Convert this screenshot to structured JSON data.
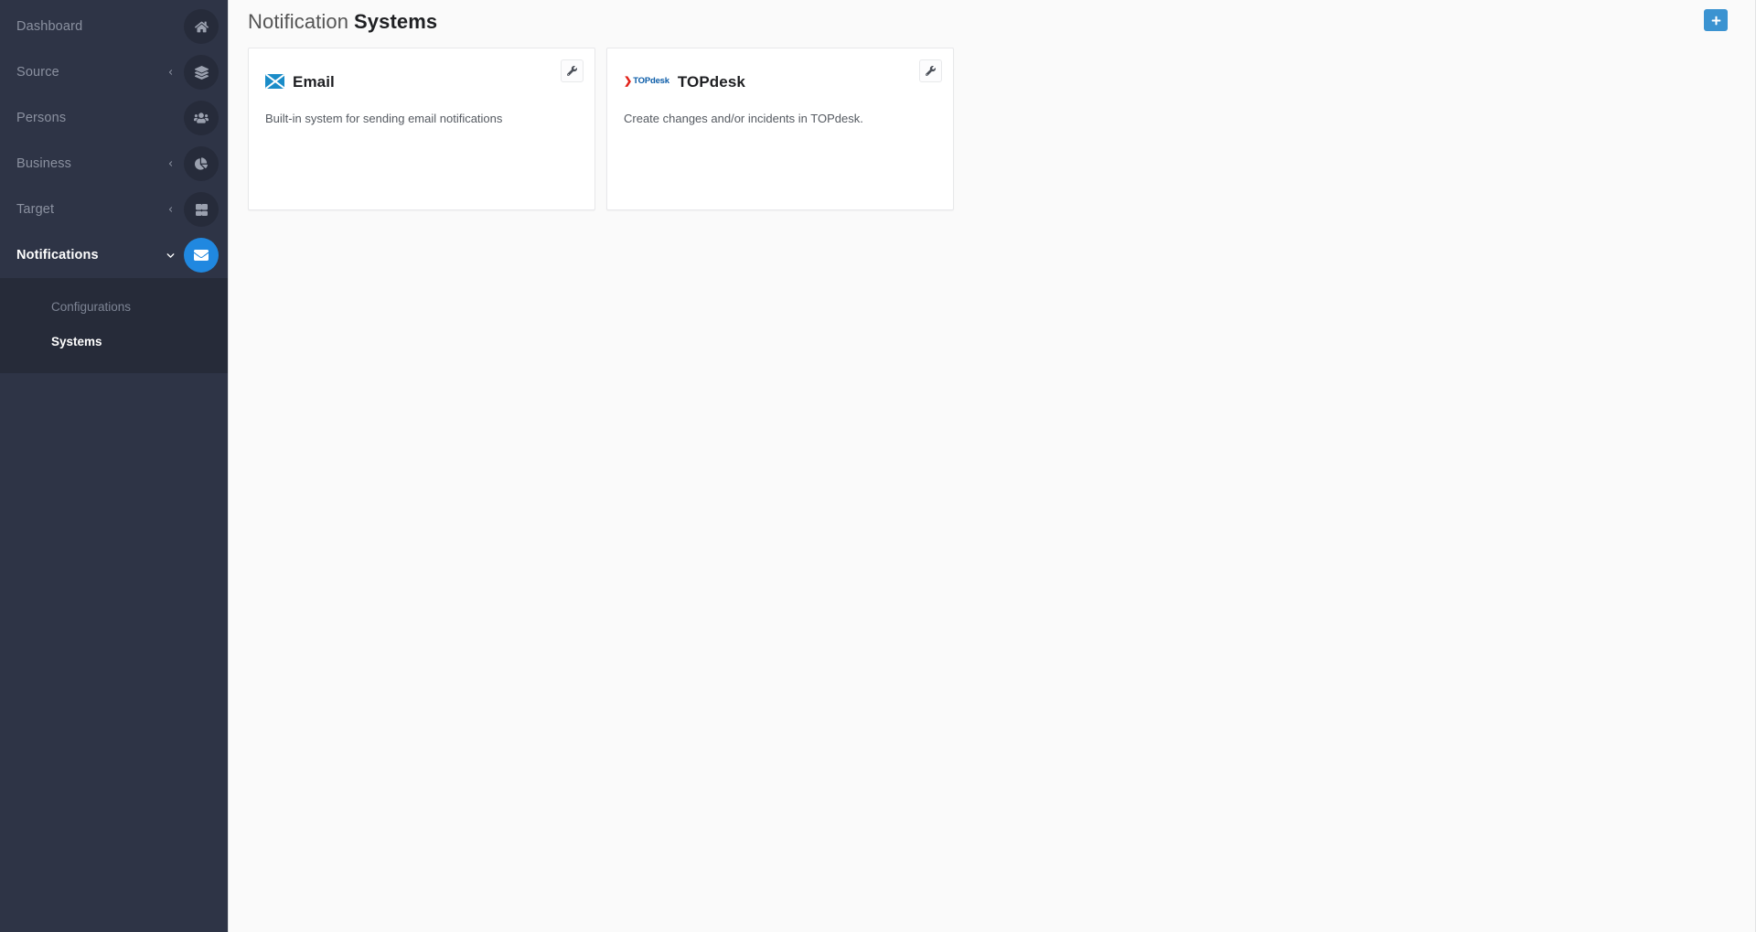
{
  "sidebar": {
    "items": [
      {
        "label": "Dashboard",
        "icon": "home-icon",
        "caret": "none",
        "active": false,
        "expanded": false
      },
      {
        "label": "Source",
        "icon": "layers-icon",
        "caret": "chevron-left",
        "active": false,
        "expanded": false
      },
      {
        "label": "Persons",
        "icon": "users-icon",
        "caret": "none",
        "active": false,
        "expanded": false
      },
      {
        "label": "Business",
        "icon": "pie-chart-icon",
        "caret": "chevron-left",
        "active": false,
        "expanded": false
      },
      {
        "label": "Target",
        "icon": "grid-icon",
        "caret": "chevron-left",
        "active": false,
        "expanded": false
      },
      {
        "label": "Notifications",
        "icon": "envelope-icon",
        "caret": "chevron-down",
        "active": true,
        "expanded": true
      }
    ],
    "submenu": [
      {
        "label": "Configurations",
        "active": false
      },
      {
        "label": "Systems",
        "active": true
      }
    ],
    "colors": {
      "background": "#2e3446",
      "submenu_background": "#262b39",
      "accent": "#2088e0",
      "muted_text": "#8b91a0"
    }
  },
  "header": {
    "title_light": "Notification",
    "title_bold": "Systems",
    "add_button_label": "+",
    "add_button_icon": "plus-icon",
    "add_button_color": "#3b93d1"
  },
  "cards": [
    {
      "name": "Email",
      "description": "Built-in system for sending email notifications",
      "logo": "email-envelope-logo",
      "logo_color": "#1a8cc8",
      "action_icon": "wrench-icon"
    },
    {
      "name": "TOPdesk",
      "description": "Create changes and/or incidents in TOPdesk.",
      "logo": "topdesk-logo",
      "logo_text": "TOPdesk",
      "logo_arrow": "❯",
      "logo_color": "#0b5ca8",
      "logo_accent_color": "#e2231a",
      "action_icon": "wrench-icon"
    }
  ]
}
